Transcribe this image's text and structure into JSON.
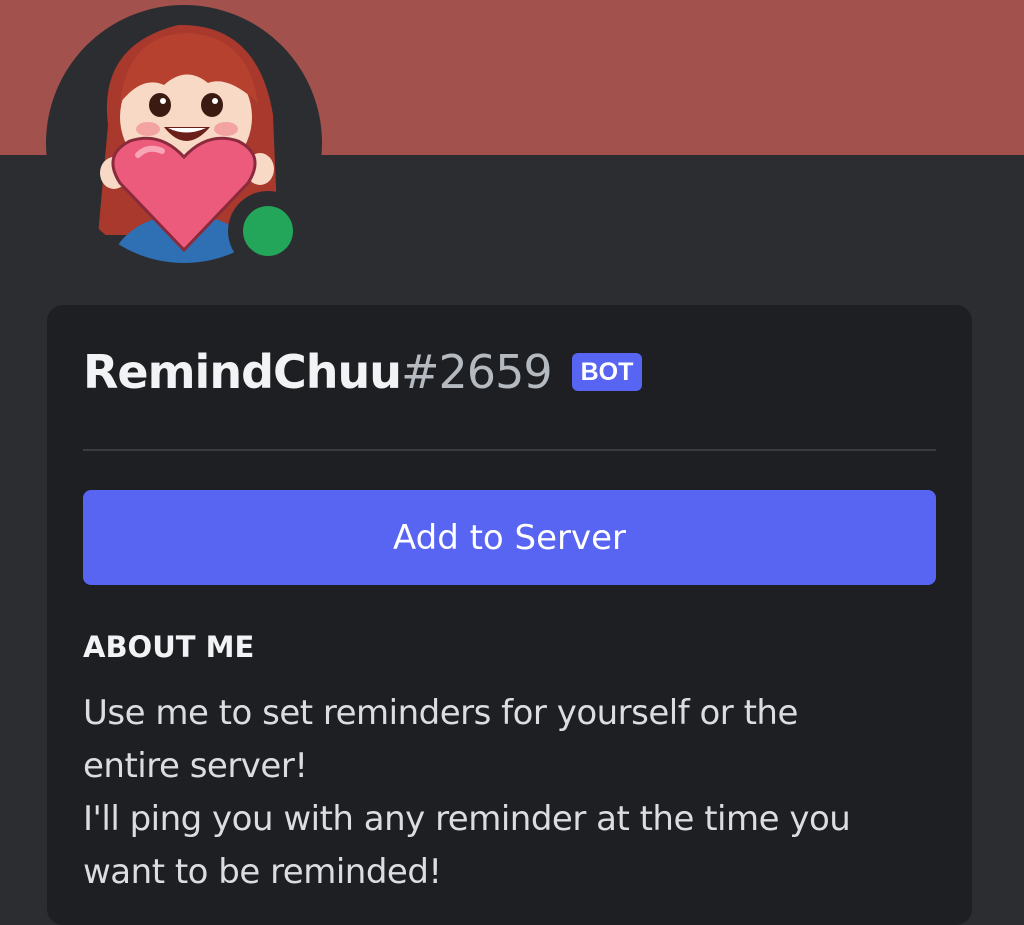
{
  "banner": {
    "color": "#a2514d"
  },
  "avatar": {
    "status": "online",
    "status_color": "#23a55a"
  },
  "profile": {
    "username": "RemindChuu",
    "discriminator": "#2659",
    "badge": "BOT"
  },
  "actions": {
    "add_to_server_label": "Add to Server"
  },
  "about": {
    "title": "ABOUT ME",
    "lines": [
      "Use me to set reminders for yourself or the",
      "entire server!",
      "I'll ping you with any reminder at the time you",
      "want to be reminded!"
    ]
  },
  "colors": {
    "background": "#2b2d31",
    "card": "#1e1f22",
    "accent": "#5865f2"
  }
}
